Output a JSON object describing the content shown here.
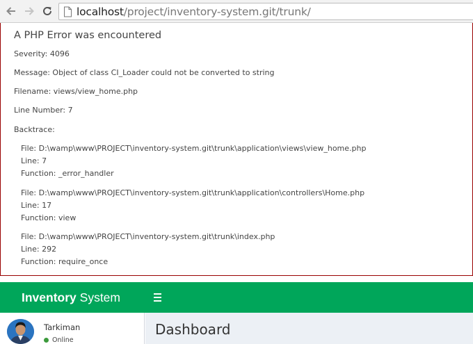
{
  "browser": {
    "url_host": "localhost",
    "url_path": "/project/inventory-system.git/trunk/"
  },
  "error": {
    "title": "A PHP Error was encountered",
    "severity": "Severity: 4096",
    "message": "Message: Object of class CI_Loader could not be converted to string",
    "filename": "Filename: views/view_home.php",
    "line_number": "Line Number: 7",
    "backtrace_label": "Backtrace:",
    "backtrace": [
      {
        "file": "File: D:\\wamp\\www\\PROJECT\\inventory-system.git\\trunk\\application\\views\\view_home.php",
        "line": "Line: 7",
        "function": "Function: _error_handler"
      },
      {
        "file": "File: D:\\wamp\\www\\PROJECT\\inventory-system.git\\trunk\\application\\controllers\\Home.php",
        "line": "Line: 17",
        "function": "Function: view"
      },
      {
        "file": "File: D:\\wamp\\www\\PROJECT\\inventory-system.git\\trunk\\index.php",
        "line": "Line: 292",
        "function": "Function: require_once"
      }
    ]
  },
  "header": {
    "brand_bold": "Inventory",
    "brand_rest": " System",
    "color": "#00a65a"
  },
  "sidebar": {
    "user_name": "Tarkiman",
    "status": "Online",
    "status_color": "#3c9a3c"
  },
  "content": {
    "page_title": "Dashboard"
  },
  "icons": [
    "back-arrow-icon",
    "forward-arrow-icon",
    "reload-icon",
    "page-icon",
    "hamburger-menu-icon"
  ]
}
